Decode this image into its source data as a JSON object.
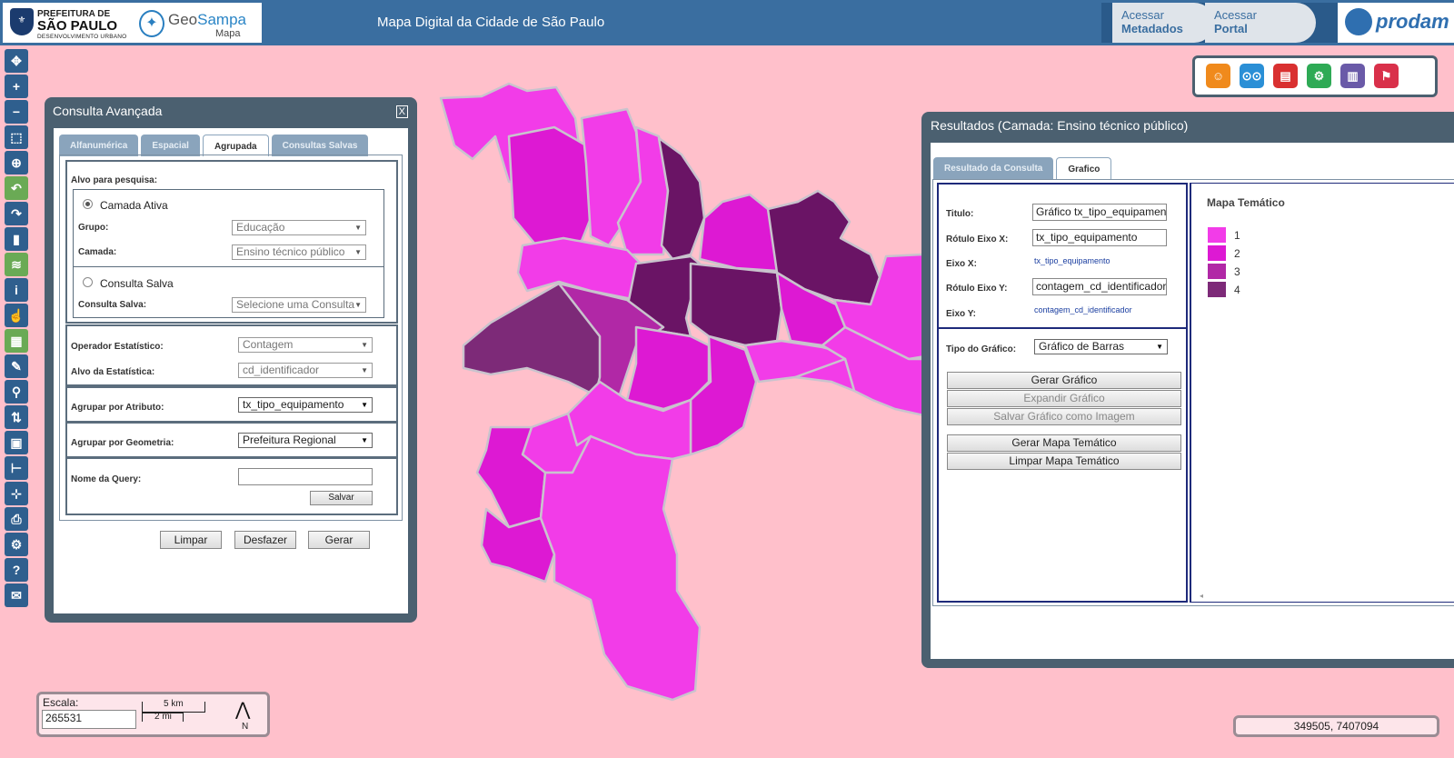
{
  "header": {
    "pref_line1": "PREFEITURA DE",
    "pref_line2": "SÃO PAULO",
    "pref_line3": "DESENVOLVIMENTO URBANO",
    "geo_a": "Geo",
    "geo_b": "Sampa",
    "geo_sub": "Mapa",
    "title": "Mapa Digital da Cidade de São Paulo",
    "acc1_l1": "Acessar",
    "acc1_l2": "Metadados",
    "acc2_l1": "Acessar",
    "acc2_l2": "Portal",
    "prodam": "prodam"
  },
  "toolbar": {
    "icons": [
      "pan-icon",
      "zoom-in-icon",
      "zoom-out-icon",
      "zoom-box-icon",
      "globe-icon",
      "undo-icon",
      "redo-icon",
      "bookmark-icon",
      "layers-icon",
      "info-icon",
      "hand-pointer-icon",
      "table-icon",
      "draw-icon",
      "search-icon",
      "sync-icon",
      "save-icon",
      "measure-icon",
      "crosshair-icon",
      "print-icon",
      "settings-icon",
      "help-icon",
      "mail-icon"
    ],
    "glyphs": [
      "✥",
      "+",
      "−",
      "⬚",
      "⊕",
      "↶",
      "↷",
      "▮",
      "≋",
      "i",
      "☝",
      "▦",
      "✎",
      "⚲",
      "⇅",
      "▣",
      "⊢",
      "⊹",
      "⎙",
      "⚙",
      "?",
      "✉"
    ]
  },
  "adv": {
    "title": "Consulta Avançada",
    "close": "X",
    "tabs": [
      "Alfanumérica",
      "Espacial",
      "Agrupada",
      "Consultas Salvas"
    ],
    "alvo": "Alvo para pesquisa:",
    "camada_ativa": "Camada Ativa",
    "grupo_lbl": "Grupo:",
    "grupo_val": "Educação",
    "camada_lbl": "Camada:",
    "camada_val": "Ensino técnico público",
    "consulta_salva": "Consulta Salva",
    "cs_lbl": "Consulta Salva:",
    "cs_val": "Selecione uma Consulta",
    "op_lbl": "Operador Estatístico:",
    "op_val": "Contagem",
    "alvo_est_lbl": "Alvo da Estatística:",
    "alvo_est_val": "cd_identificador",
    "agr_attr_lbl": "Agrupar por Atributo:",
    "agr_attr_val": "tx_tipo_equipamento",
    "agr_geo_lbl": "Agrupar por Geometria:",
    "agr_geo_val": "Prefeitura Regional",
    "nome_lbl": "Nome da Query:",
    "salvar": "Salvar",
    "limpar": "Limpar",
    "desfazer": "Desfazer",
    "gerar": "Gerar"
  },
  "res": {
    "title": "Resultados (Camada: Ensino técnico público)",
    "tabs": [
      "Resultado da Consulta",
      "Grafico"
    ],
    "titulo_lbl": "Titulo:",
    "titulo_val": "Gráfico tx_tipo_equipamento",
    "rx_lbl": "Rótulo Eixo X:",
    "rx_val": "tx_tipo_equipamento",
    "ex_lbl": "Eixo X:",
    "ex_val": "tx_tipo_equipamento",
    "ry_lbl": "Rótulo Eixo Y:",
    "ry_val": "contagem_cd_identificador",
    "ey_lbl": "Eixo Y:",
    "ey_val": "contagem_cd_identificador",
    "tipo_lbl": "Tipo do Gráfico:",
    "tipo_val": "Gráfico de Barras",
    "btn_gerar_graf": "Gerar Gráfico",
    "btn_expandir": "Expandir Gráfico",
    "btn_salvar_img": "Salvar Gráfico como Imagem",
    "btn_gerar_mapa": "Gerar Mapa Temático",
    "btn_limpar_mapa": "Limpar Mapa Temático",
    "mt_title": "Mapa Temático",
    "legend": [
      {
        "label": "1",
        "color": "#f23ce8"
      },
      {
        "label": "2",
        "color": "#dd19d3"
      },
      {
        "label": "3",
        "color": "#b128a6"
      },
      {
        "label": "4",
        "color": "#7d2a78"
      }
    ]
  },
  "top_icons": [
    {
      "name": "theater-icon",
      "glyph": "☺",
      "color": "#f08a1c"
    },
    {
      "name": "binoculars-icon",
      "glyph": "⊙⊙",
      "color": "#2a8fd6"
    },
    {
      "name": "bus-icon",
      "glyph": "▤",
      "color": "#d93030"
    },
    {
      "name": "tractor-icon",
      "glyph": "⚙",
      "color": "#2eaa55"
    },
    {
      "name": "chart-icon",
      "glyph": "▥",
      "color": "#6a5aa8"
    },
    {
      "name": "map-pin-icon",
      "glyph": "⚑",
      "color": "#d9304a"
    }
  ],
  "scale": {
    "label": "Escala:",
    "value": "265531",
    "km": "5 km",
    "mi": "2 mi",
    "north": "N"
  },
  "coords": "349505, 7407094",
  "map_colors": {
    "c1": "#f23ce8",
    "c2": "#dd19d3",
    "c3": "#b128a6",
    "c4": "#6a1465",
    "stroke": "#c9c3cd"
  }
}
